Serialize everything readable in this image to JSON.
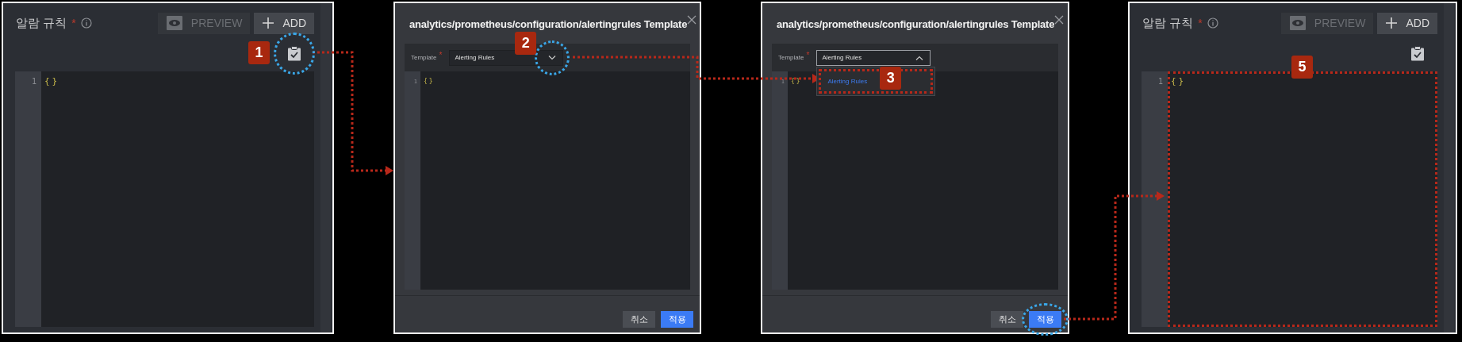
{
  "panels": [
    {
      "kind": "editor",
      "title": "알람 규칙",
      "required_mark": "*",
      "buttons": [
        {
          "label": "PREVIEW",
          "disabled": true
        },
        {
          "label": "ADD",
          "disabled": false
        }
      ],
      "lines": [
        {
          "number": "1",
          "code": "{}"
        }
      ],
      "badge": "1"
    },
    {
      "kind": "dialog",
      "title": "analytics/prometheus/configuration/alertingrules Template",
      "field_label": "Template",
      "required_mark": "*",
      "select": {
        "value": "Alerting Rules",
        "expanded": false
      },
      "lines": [
        {
          "number": "1",
          "code": "{}"
        }
      ],
      "buttons": [
        {
          "label": "취소",
          "primary": false
        },
        {
          "label": "적용",
          "primary": true
        }
      ],
      "badge": "2"
    },
    {
      "kind": "dialog",
      "title": "analytics/prometheus/configuration/alertingrules Template",
      "field_label": "Template",
      "required_mark": "*",
      "select": {
        "value": "Alerting Rules",
        "expanded": true,
        "options": [
          {
            "label": "Alerting Rules",
            "selected": true
          }
        ]
      },
      "lines": [
        {
          "number": "1",
          "code": "{}"
        }
      ],
      "buttons": [
        {
          "label": "취소",
          "primary": false
        },
        {
          "label": "적용",
          "primary": true
        }
      ],
      "badge": "3"
    },
    {
      "kind": "editor",
      "title": "알람 규칙",
      "required_mark": "*",
      "buttons": [
        {
          "label": "PREVIEW",
          "disabled": true
        },
        {
          "label": "ADD",
          "disabled": false
        }
      ],
      "lines": [
        {
          "number": "1",
          "code": "{}"
        }
      ],
      "badge": "5"
    }
  ]
}
